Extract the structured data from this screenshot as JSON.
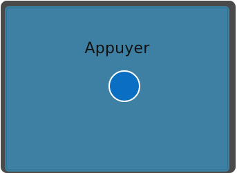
{
  "screen": {
    "title": "Appuyer",
    "colors": {
      "frame": "#4a4a4a",
      "panel": "#3e80a3",
      "button_fill": "#0a6fc2",
      "button_border": "#ffffff",
      "title_text": "#111111"
    }
  }
}
